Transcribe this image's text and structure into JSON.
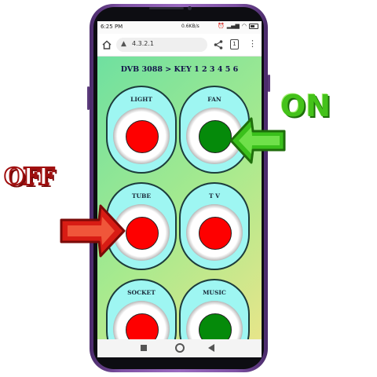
{
  "statusbar": {
    "time": "6:25 PM",
    "net_speed": "0.6KB/s"
  },
  "browser": {
    "url": "4.3.2.1",
    "tab_count": "1"
  },
  "page": {
    "header": "DVB 3088 > KEY 1 2 3 4 5 6"
  },
  "switches": [
    {
      "label": "LIGHT",
      "state": "off",
      "color": "#fe0000"
    },
    {
      "label": "FAN",
      "state": "on",
      "color": "#058a0a"
    },
    {
      "label": "TUBE",
      "state": "off",
      "color": "#fe0000"
    },
    {
      "label": "T V",
      "state": "off",
      "color": "#fe0000"
    },
    {
      "label": "SOCKET",
      "state": "off",
      "color": "#fe0000"
    },
    {
      "label": "MUSIC",
      "state": "on",
      "color": "#058a0a"
    }
  ],
  "annotations": {
    "on_text": "ON",
    "off_text": "OFF",
    "on_color": "#44c21a",
    "off_color": "#d02020"
  },
  "icons": [
    "home-icon",
    "warning-icon",
    "share-icon",
    "tabs-icon",
    "menu-icon",
    "recents-icon",
    "nav-home-icon",
    "back-icon"
  ]
}
